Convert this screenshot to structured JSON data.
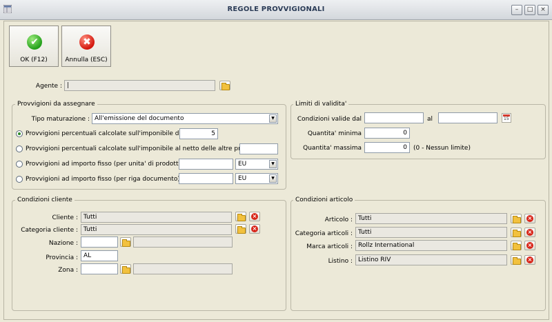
{
  "window": {
    "title": "REGOLE PROVVIGIONALI",
    "min_icon": "minimize-icon",
    "max_icon": "maximize-icon",
    "close_icon": "close-icon"
  },
  "toolbar": {
    "ok_label": "OK (F12)",
    "cancel_label": "Annulla (ESC)"
  },
  "agente": {
    "label": "Agente :",
    "value": "|"
  },
  "provvigioni": {
    "title": "Provvigioni da assegnare",
    "tipo_label": "Tipo maturazione :",
    "tipo_value": "All'emissione del documento",
    "options": [
      {
        "label": "Provvigioni percentuali calcolate sull'imponibile di riga",
        "value": "5",
        "checked": true
      },
      {
        "label": "Provvigioni percentuali calcolate sull'imponibile al netto delle altre provvigioni",
        "value": ""
      },
      {
        "label": "Provvigioni ad importo fisso (per unita' di prodotto)",
        "value": "",
        "unit": "EU"
      },
      {
        "label": "Provvigioni ad importo fisso (per riga documento)",
        "value": "",
        "unit": "EU"
      }
    ]
  },
  "limiti": {
    "title": "Limiti di validita'",
    "dal_label": "Condizioni valide dal",
    "al_label": "al",
    "dal_value": "",
    "al_value": "",
    "qmin_label": "Quantita' minima",
    "qmin_value": "0",
    "qmax_label": "Quantita' massima",
    "qmax_value": "0",
    "qmax_note": "(0 - Nessun limite)"
  },
  "cliente": {
    "title": "Condizioni cliente",
    "cliente_label": "Cliente :",
    "cliente_value": "Tutti",
    "categoria_label": "Categoria cliente :",
    "categoria_value": "Tutti",
    "nazione_label": "Nazione :",
    "nazione_value": "",
    "provincia_label": "Provincia :",
    "provincia_value": "AL",
    "zona_label": "Zona :",
    "zona_value": ""
  },
  "articolo": {
    "title": "Condizioni articolo",
    "articolo_label": "Articolo :",
    "articolo_value": "Tutti",
    "categoria_label": "Categoria articoli :",
    "categoria_value": "Tutti",
    "marca_label": "Marca articoli :",
    "marca_value": "Rollz International",
    "listino_label": "Listino :",
    "listino_value": "Listino RIV"
  }
}
